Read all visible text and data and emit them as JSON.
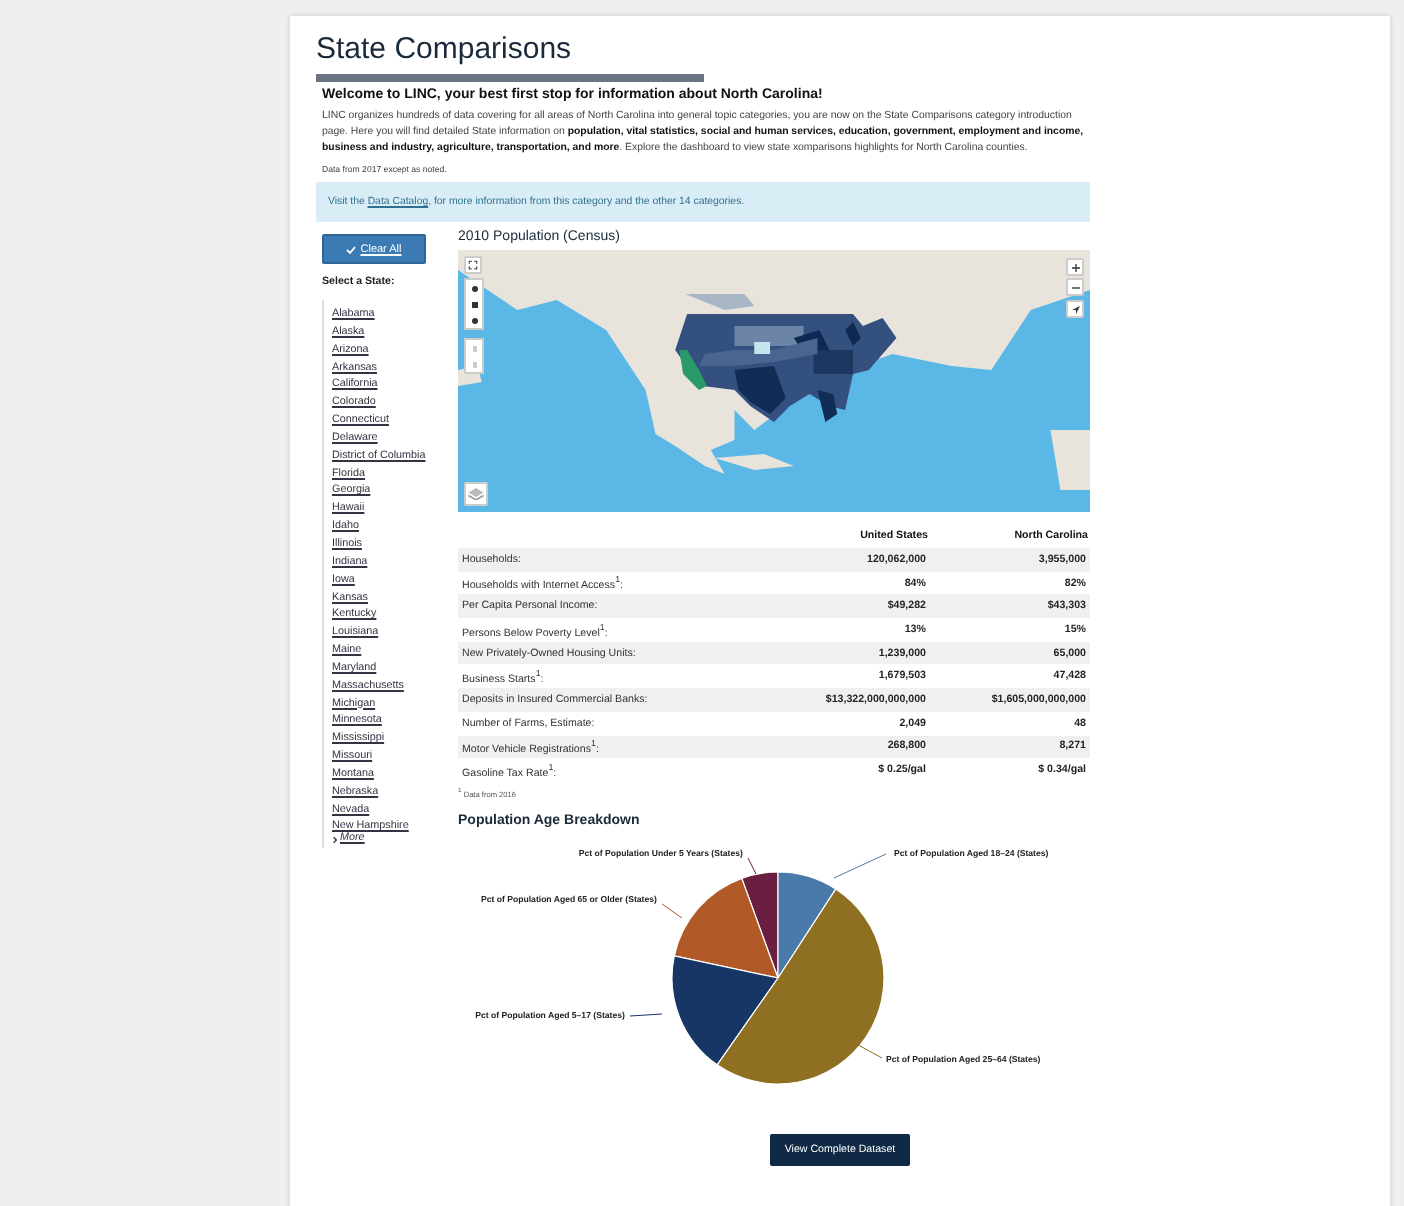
{
  "page": {
    "title": "State Comparisons"
  },
  "intro": {
    "heading": "Welcome to LINC, your best first stop for information about North Carolina!",
    "paragraph": "LINC organizes hundreds of data covering for all areas of North Carolina into general topic categories, you are now on the State Comparisons category introduction page. Here you will find detailed State information on **population, vital statistics, social and human services, education, government, employment and income, business and industry, agriculture, transportation, and more**. Explore the dashboard to view state xomparisons highlights for North Carolina counties.",
    "note": "Data from 2017 except as noted."
  },
  "notice": {
    "before": "Visit the ",
    "link": "Data Catalog",
    "after": ", for more information from this category and the other 14 categories."
  },
  "sidebar": {
    "clear_button": "Clear All",
    "heading": "Select a State:",
    "states": [
      "Alabama",
      "Alaska",
      "Arizona",
      "Arkansas",
      "California",
      "Colorado",
      "Connecticut",
      "Delaware",
      "District of Columbia",
      "Florida",
      "Georgia",
      "Hawaii",
      "Idaho",
      "Illinois",
      "Indiana",
      "Iowa",
      "Kansas",
      "Kentucky",
      "Louisiana",
      "Maine",
      "Maryland",
      "Massachusetts",
      "Michigan",
      "Minnesota",
      "Mississippi",
      "Missouri",
      "Montana",
      "Nebraska",
      "Nevada",
      "New Hampshire"
    ],
    "more": "More"
  },
  "map": {
    "title": "2010 Population (Census)",
    "kind": "picture"
  },
  "table": {
    "columns": [
      "United States",
      "North Carolina"
    ],
    "rows": [
      {
        "label": "Households:",
        "values": [
          "120,062,000",
          "3,955,000"
        ]
      },
      {
        "label": "Households with Internet Access$^{1}$:",
        "values": [
          "84%",
          "82%"
        ]
      },
      {
        "label": "Per Capita Personal Income:",
        "values": [
          "$49,282",
          "$43,303"
        ]
      },
      {
        "label": "Persons Below Poverty Level$^{1}$:",
        "values": [
          "13%",
          "15%"
        ]
      },
      {
        "label": "New Privately-Owned Housing Units:",
        "values": [
          "1,239,000",
          "65,000"
        ]
      },
      {
        "label": "Business Starts$^{1}$:",
        "values": [
          "1,679,503",
          "47,428"
        ]
      },
      {
        "label": "Deposits in Insured Commercial Banks:",
        "values": [
          "$13,322,000,000,000",
          "$1,605,000,000,000"
        ]
      },
      {
        "label": "Number of Farms, Estimate:",
        "values": [
          "2,049",
          "48"
        ]
      },
      {
        "label": "Motor Vehicle Registrations$^{1}$:",
        "values": [
          "268,800",
          "8,271"
        ]
      },
      {
        "label": "Gasoline Tax Rate$^{1}$:",
        "values": [
          "$ 0.25/gal",
          "$ 0.34/gal"
        ]
      }
    ],
    "footnote": "$^{1}$ Data from 2016"
  },
  "pie": {
    "title": "Population Age Breakdown",
    "slices": [
      {
        "label": "Pct of Population Under 5 Years (States)",
        "color": "#6a1f42"
      },
      {
        "label": "Pct of Population Aged 18–24 (States)",
        "color": "#4a7aaa"
      },
      {
        "label": "Pct of Population Aged 65 or Older (States)",
        "color": "#b25a27"
      },
      {
        "label": "Pct of Population Aged 5–17 (States)",
        "color": "#173666"
      },
      {
        "label": "Pct of Population Aged 25–64 (States)",
        "color": "#8f6f22"
      }
    ]
  },
  "dataset_button": "View Complete Dataset"
}
